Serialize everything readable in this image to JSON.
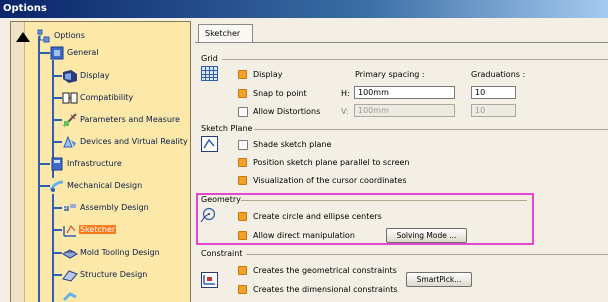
{
  "window": {
    "title": "Options"
  },
  "tree": {
    "root": "Options",
    "items": [
      {
        "label": "General"
      },
      {
        "label": "Display"
      },
      {
        "label": "Compatibility"
      },
      {
        "label": "Parameters and Measure"
      },
      {
        "label": "Devices and Virtual Reality"
      },
      {
        "label": "Infrastructure"
      },
      {
        "label": "Mechanical Design"
      },
      {
        "label": "Assembly Design"
      },
      {
        "label": "Sketcher",
        "selected": true
      },
      {
        "label": "Mold Tooling Design"
      },
      {
        "label": "Structure Design"
      }
    ]
  },
  "tabs": [
    {
      "label": "Sketcher",
      "active": true
    }
  ],
  "grid": {
    "title": "Grid",
    "display": {
      "label": "Display",
      "checked": true
    },
    "snap": {
      "label": "Snap to point",
      "checked": true
    },
    "distortions": {
      "label": "Allow Distortions",
      "checked": false
    },
    "primary_spacing_label": "Primary spacing :",
    "graduations_label": "Graduations :",
    "h_label": "H:",
    "v_label": "V:",
    "h_value": "100mm",
    "v_value": "100mm",
    "h_grad": "10",
    "v_grad": "10"
  },
  "sketch_plane": {
    "title": "Sketch Plane",
    "shade": {
      "label": "Shade sketch plane",
      "checked": false
    },
    "position": {
      "label": "Position sketch plane parallel to screen",
      "checked": true
    },
    "visualization": {
      "label": "Visualization of the cursor coordinates",
      "checked": true
    }
  },
  "geometry": {
    "title": "Geometry",
    "create": {
      "label": "Create circle and ellipse centers",
      "checked": true
    },
    "manip": {
      "label": "Allow direct manipulation",
      "checked": true
    },
    "solving_button": "Solving Mode ..."
  },
  "constraint": {
    "title": "Constraint",
    "geom": {
      "label": "Creates the geometrical constraints",
      "checked": true
    },
    "dim": {
      "label": "Creates the dimensional constraints",
      "checked": true
    },
    "smartpick_button": "SmartPick..."
  },
  "colors": {
    "accent_orange": "#f2a22a",
    "highlight": "#e447d0",
    "tree_bg": "#fce8a8",
    "selected": "#ff7a1c"
  }
}
